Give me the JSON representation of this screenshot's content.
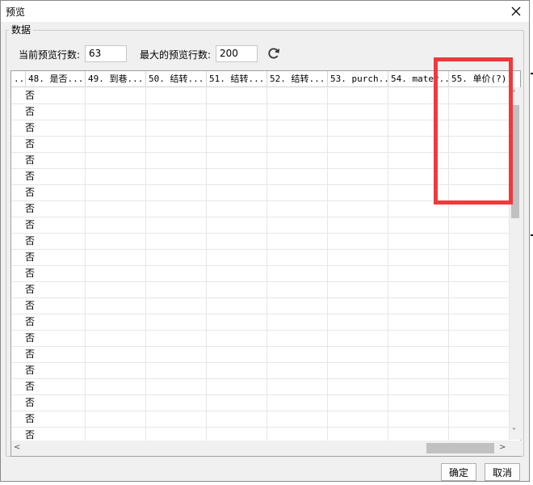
{
  "window": {
    "title": "预览"
  },
  "group": {
    "title": "数据"
  },
  "settings": {
    "current_rows_label": "当前预览行数:",
    "current_rows_value": "63",
    "max_rows_label": "最大的预览行数:",
    "max_rows_value": "200"
  },
  "table": {
    "columns": [
      "..",
      "48. 是否...",
      "49. 到巷...",
      "50. 结转...",
      "51. 结转...",
      "52. 结转...",
      "53. purch...",
      "54. mater...",
      "55. 单价(?)"
    ],
    "first_column_values": [
      "否",
      "否",
      "否",
      "否",
      "否",
      "否",
      "否",
      "否",
      "否",
      "否",
      "否",
      "否",
      "否",
      "否",
      "否",
      "否",
      "否",
      "否",
      "否",
      "否",
      "否",
      "否"
    ]
  },
  "buttons": {
    "ok": "确定",
    "cancel": "取消"
  },
  "colors": {
    "highlight": "#f0393c",
    "dialog_bg": "#f0f0f0"
  },
  "icons": {
    "close": "close-icon",
    "refresh": "refresh-icon"
  }
}
